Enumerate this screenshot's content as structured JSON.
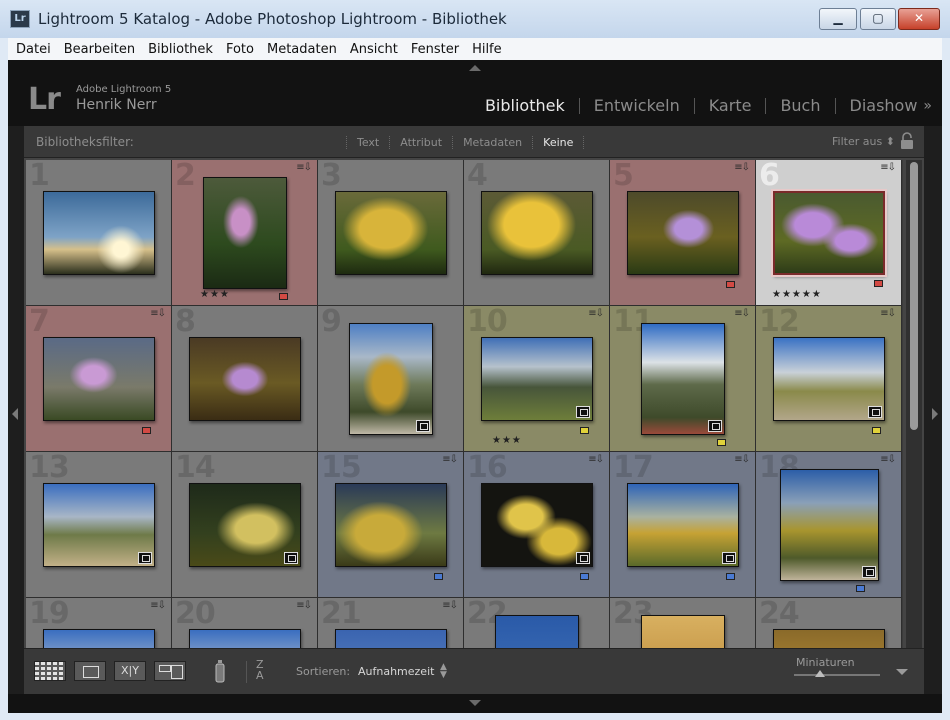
{
  "window": {
    "title": "Lightroom 5 Katalog - Adobe Photoshop Lightroom - Bibliothek",
    "app_icon_text": "Lr",
    "minimize_glyph": "▁",
    "maximize_glyph": "▢",
    "close_glyph": "✕"
  },
  "menu": [
    "Datei",
    "Bearbeiten",
    "Bibliothek",
    "Foto",
    "Metadaten",
    "Ansicht",
    "Fenster",
    "Hilfe"
  ],
  "header": {
    "logo_text": "Lr",
    "product": "Adobe Lightroom 5",
    "user": "Henrik Nerr",
    "modules": [
      "Bibliothek",
      "Entwickeln",
      "Karte",
      "Buch",
      "Diashow"
    ],
    "active_module": "Bibliothek",
    "more_glyph": "»"
  },
  "filter": {
    "label": "Bibliotheksfilter:",
    "tabs": [
      "Text",
      "Attribut",
      "Metadaten",
      "Keine"
    ],
    "active_tab": "Keine",
    "filter_off": "Filter aus ⬍"
  },
  "colors": {
    "none": "#7a7a7a",
    "red": "#d24a44",
    "yellow": "#e0d23a",
    "blue": "#4a7ad2",
    "selected": "#cfcfcf"
  },
  "grid": {
    "flag_badge": "≡⇩",
    "star_glyph": "★",
    "cells": [
      {
        "num": "1",
        "color": "none",
        "orient": "landscape",
        "photo": "branches",
        "stars": 0,
        "label": "",
        "stack": false,
        "badge": false,
        "selected": false
      },
      {
        "num": "2",
        "color": "red",
        "orient": "portrait",
        "photo": "crocus-a",
        "stars": 3,
        "label": "red",
        "stack": false,
        "badge": true,
        "selected": false
      },
      {
        "num": "3",
        "color": "none",
        "orient": "landscape",
        "photo": "leaf-a",
        "stars": 0,
        "label": "",
        "stack": false,
        "badge": false,
        "selected": false
      },
      {
        "num": "4",
        "color": "none",
        "orient": "landscape",
        "photo": "leaf-b",
        "stars": 0,
        "label": "",
        "stack": false,
        "badge": false,
        "selected": false
      },
      {
        "num": "5",
        "color": "red",
        "orient": "landscape",
        "photo": "crocus-b",
        "stars": 0,
        "label": "red",
        "stack": false,
        "badge": true,
        "selected": false
      },
      {
        "num": "6",
        "color": "none",
        "orient": "landscape",
        "photo": "crocus-c",
        "stars": 5,
        "label": "red",
        "stack": false,
        "badge": true,
        "selected": true
      },
      {
        "num": "7",
        "color": "red",
        "orient": "landscape",
        "photo": "crocus-d",
        "stars": 0,
        "label": "red",
        "stack": false,
        "badge": true,
        "selected": false
      },
      {
        "num": "8",
        "color": "none",
        "orient": "landscape",
        "photo": "crocus-e",
        "stars": 0,
        "label": "",
        "stack": false,
        "badge": false,
        "selected": false
      },
      {
        "num": "9",
        "color": "none",
        "orient": "portrait",
        "photo": "mountain-tree",
        "stars": 0,
        "label": "",
        "stack": true,
        "badge": false,
        "selected": false
      },
      {
        "num": "10",
        "color": "yellow",
        "orient": "landscape",
        "photo": "mountain-meadow",
        "stars": 3,
        "label": "yellow",
        "stack": true,
        "badge": true,
        "selected": false
      },
      {
        "num": "11",
        "color": "yellow",
        "orient": "portrait",
        "photo": "mountain-hut",
        "stars": 0,
        "label": "yellow",
        "stack": true,
        "badge": true,
        "selected": false
      },
      {
        "num": "12",
        "color": "yellow",
        "orient": "landscape",
        "photo": "mountain-path",
        "stars": 0,
        "label": "yellow",
        "stack": true,
        "badge": true,
        "selected": false
      },
      {
        "num": "13",
        "color": "none",
        "orient": "landscape",
        "photo": "mountain-wide",
        "stars": 0,
        "label": "",
        "stack": true,
        "badge": false,
        "selected": false
      },
      {
        "num": "14",
        "color": "none",
        "orient": "landscape",
        "photo": "leaves-dark",
        "stars": 0,
        "label": "",
        "stack": true,
        "badge": false,
        "selected": false
      },
      {
        "num": "15",
        "color": "blue",
        "orient": "landscape",
        "photo": "leaves-sky",
        "stars": 0,
        "label": "blue",
        "stack": false,
        "badge": true,
        "selected": false
      },
      {
        "num": "16",
        "color": "blue",
        "orient": "landscape",
        "photo": "leaves-black",
        "stars": 0,
        "label": "blue",
        "stack": true,
        "badge": true,
        "selected": false
      },
      {
        "num": "17",
        "color": "blue",
        "orient": "landscape",
        "photo": "autumn-slope",
        "stars": 0,
        "label": "blue",
        "stack": true,
        "badge": true,
        "selected": false
      },
      {
        "num": "18",
        "color": "blue",
        "orient": "tall",
        "photo": "autumn-path",
        "stars": 0,
        "label": "blue",
        "stack": true,
        "badge": true,
        "selected": false
      },
      {
        "num": "19",
        "color": "none",
        "orient": "landscape",
        "photo": "peek-mountain",
        "stars": 0,
        "label": "",
        "stack": false,
        "badge": true,
        "selected": false
      },
      {
        "num": "20",
        "color": "none",
        "orient": "landscape",
        "photo": "peek-mountain",
        "stars": 0,
        "label": "",
        "stack": false,
        "badge": true,
        "selected": false
      },
      {
        "num": "21",
        "color": "none",
        "orient": "landscape",
        "photo": "peek-sky",
        "stars": 0,
        "label": "",
        "stack": false,
        "badge": true,
        "selected": false
      },
      {
        "num": "22",
        "color": "none",
        "orient": "portrait",
        "photo": "peek-blue",
        "stars": 0,
        "label": "",
        "stack": false,
        "badge": false,
        "selected": false
      },
      {
        "num": "23",
        "color": "none",
        "orient": "portrait",
        "photo": "peek-autumn",
        "stars": 0,
        "label": "",
        "stack": false,
        "badge": false,
        "selected": false
      },
      {
        "num": "24",
        "color": "none",
        "orient": "landscape",
        "photo": "peek-foliage",
        "stars": 0,
        "label": "",
        "stack": false,
        "badge": false,
        "selected": false
      }
    ]
  },
  "scrollbar": {
    "position": 0.0
  },
  "toolbar": {
    "compare_label": "X|Y",
    "sort_icon": "Z\nA",
    "sort_label": "Sortieren:",
    "sort_value": "Aufnahmezeit",
    "sort_chevron": "▲\n▼",
    "thumbnail_label": "Miniaturen",
    "thumbnail_size": 0.3
  },
  "icons": {
    "lock": "lock-icon",
    "spray": "painter-spray-icon",
    "stack": "stack-icon",
    "flag": "flag-badge-icon",
    "sort": "sort-direction-icon"
  }
}
